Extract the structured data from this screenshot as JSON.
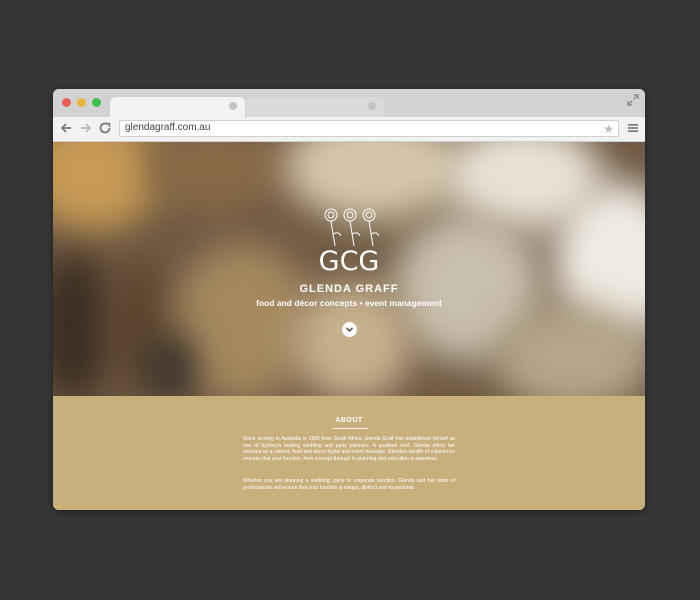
{
  "browser": {
    "url": "glendagraff.com.au"
  },
  "hero": {
    "logo_text": "GCG",
    "brand_name": "GLENDA GRAFF",
    "tagline": "food and décor concepts • event management"
  },
  "about": {
    "title": "ABOUT",
    "paragraph1": "Since arriving in Australia in 1995 from South Africa, Glenda Graff has established herself as one of Sydney's leading wedding and party planners. A qualified chef, Glenda offers her services as a caterer, food and décor stylist and event manager. Glenda's wealth of experience ensures that your function, from concept through to planning and execution is seamless.",
    "paragraph2": "Whether you are planning a wedding, party or corporate function, Glenda and her team of professionals will ensure that your function is unique, distinct and exceptional."
  },
  "colors": {
    "background": "#363636",
    "about_background": "#c8b07c"
  }
}
